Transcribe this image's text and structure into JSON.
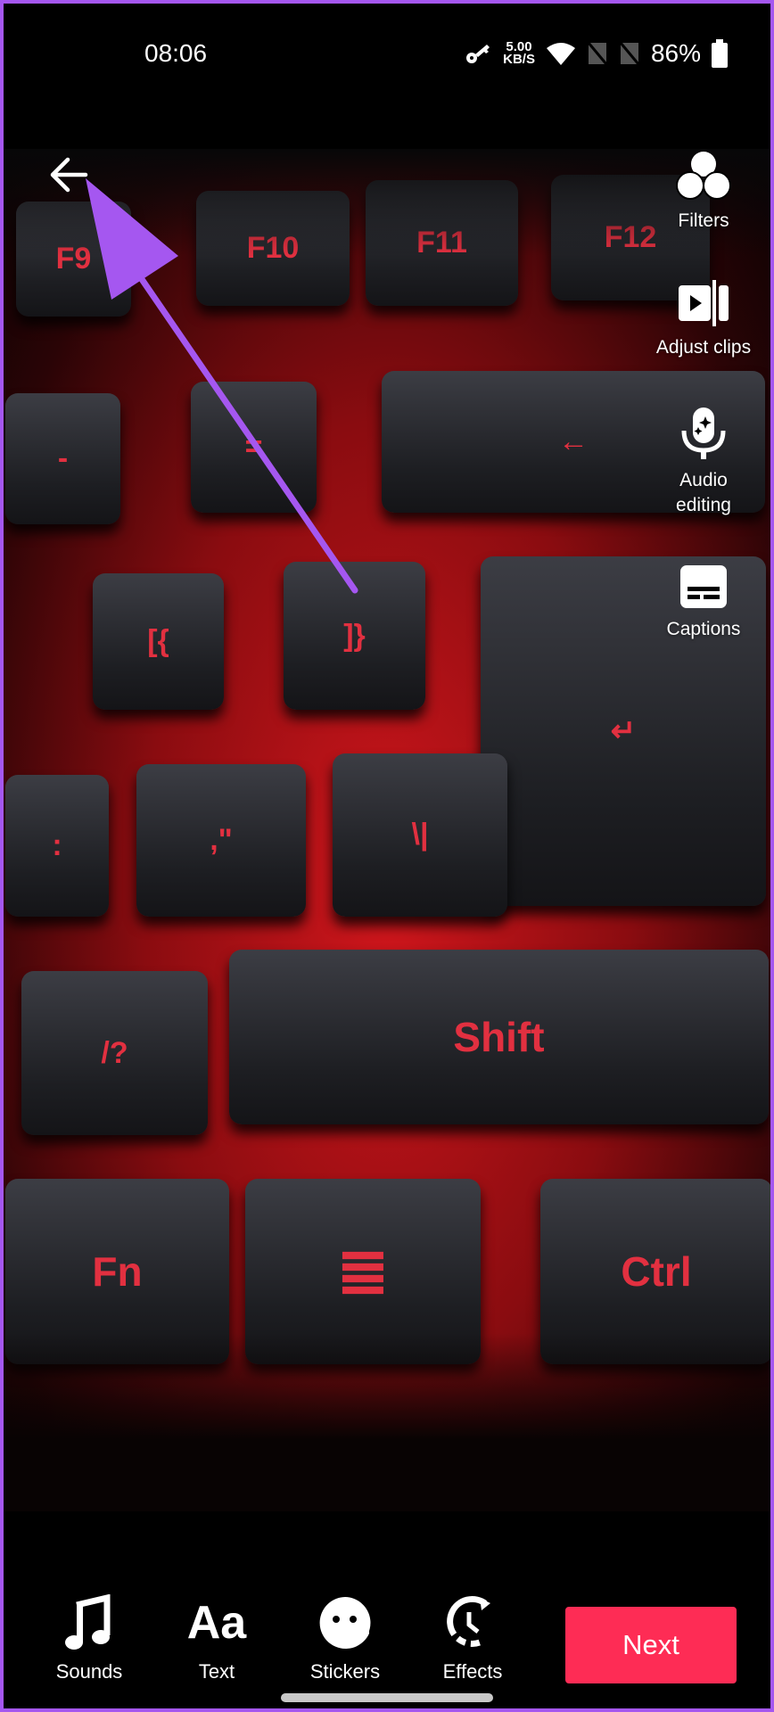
{
  "status_bar": {
    "time": "08:06",
    "net_speed_value": "5.00",
    "net_speed_unit": "KB/S",
    "battery": "86%",
    "icons": [
      "key-icon",
      "wifi-icon",
      "no-sim-icon",
      "no-sim-icon",
      "battery-icon"
    ]
  },
  "video": {
    "keycaps": [
      "F9",
      "F10",
      "F11",
      "F12",
      "-",
      "=",
      "←",
      "[{",
      "]}",
      "↵",
      ":",
      ",\"",
      "\\|",
      "/?",
      "Shift",
      "Fn",
      "≣",
      "Ctrl"
    ]
  },
  "top": {
    "back_icon": "arrow-left-icon"
  },
  "side_tools": [
    {
      "label": "Filters",
      "icon": "filters-icon"
    },
    {
      "label": "Adjust clips",
      "icon": "adjust-clips-icon"
    },
    {
      "label": "Audio",
      "label2": "editing",
      "icon": "audio-editing-icon"
    },
    {
      "label": "Captions",
      "icon": "captions-icon"
    }
  ],
  "bottom_tools": [
    {
      "label": "Sounds",
      "icon": "music-note-icon"
    },
    {
      "label": "Text",
      "icon": "text-icon",
      "glyph": "Aa"
    },
    {
      "label": "Stickers",
      "icon": "sticker-icon"
    },
    {
      "label": "Effects",
      "icon": "effects-icon"
    }
  ],
  "next_label": "Next",
  "colors": {
    "accent": "#fe2c55",
    "annotation": "#a557f0"
  }
}
